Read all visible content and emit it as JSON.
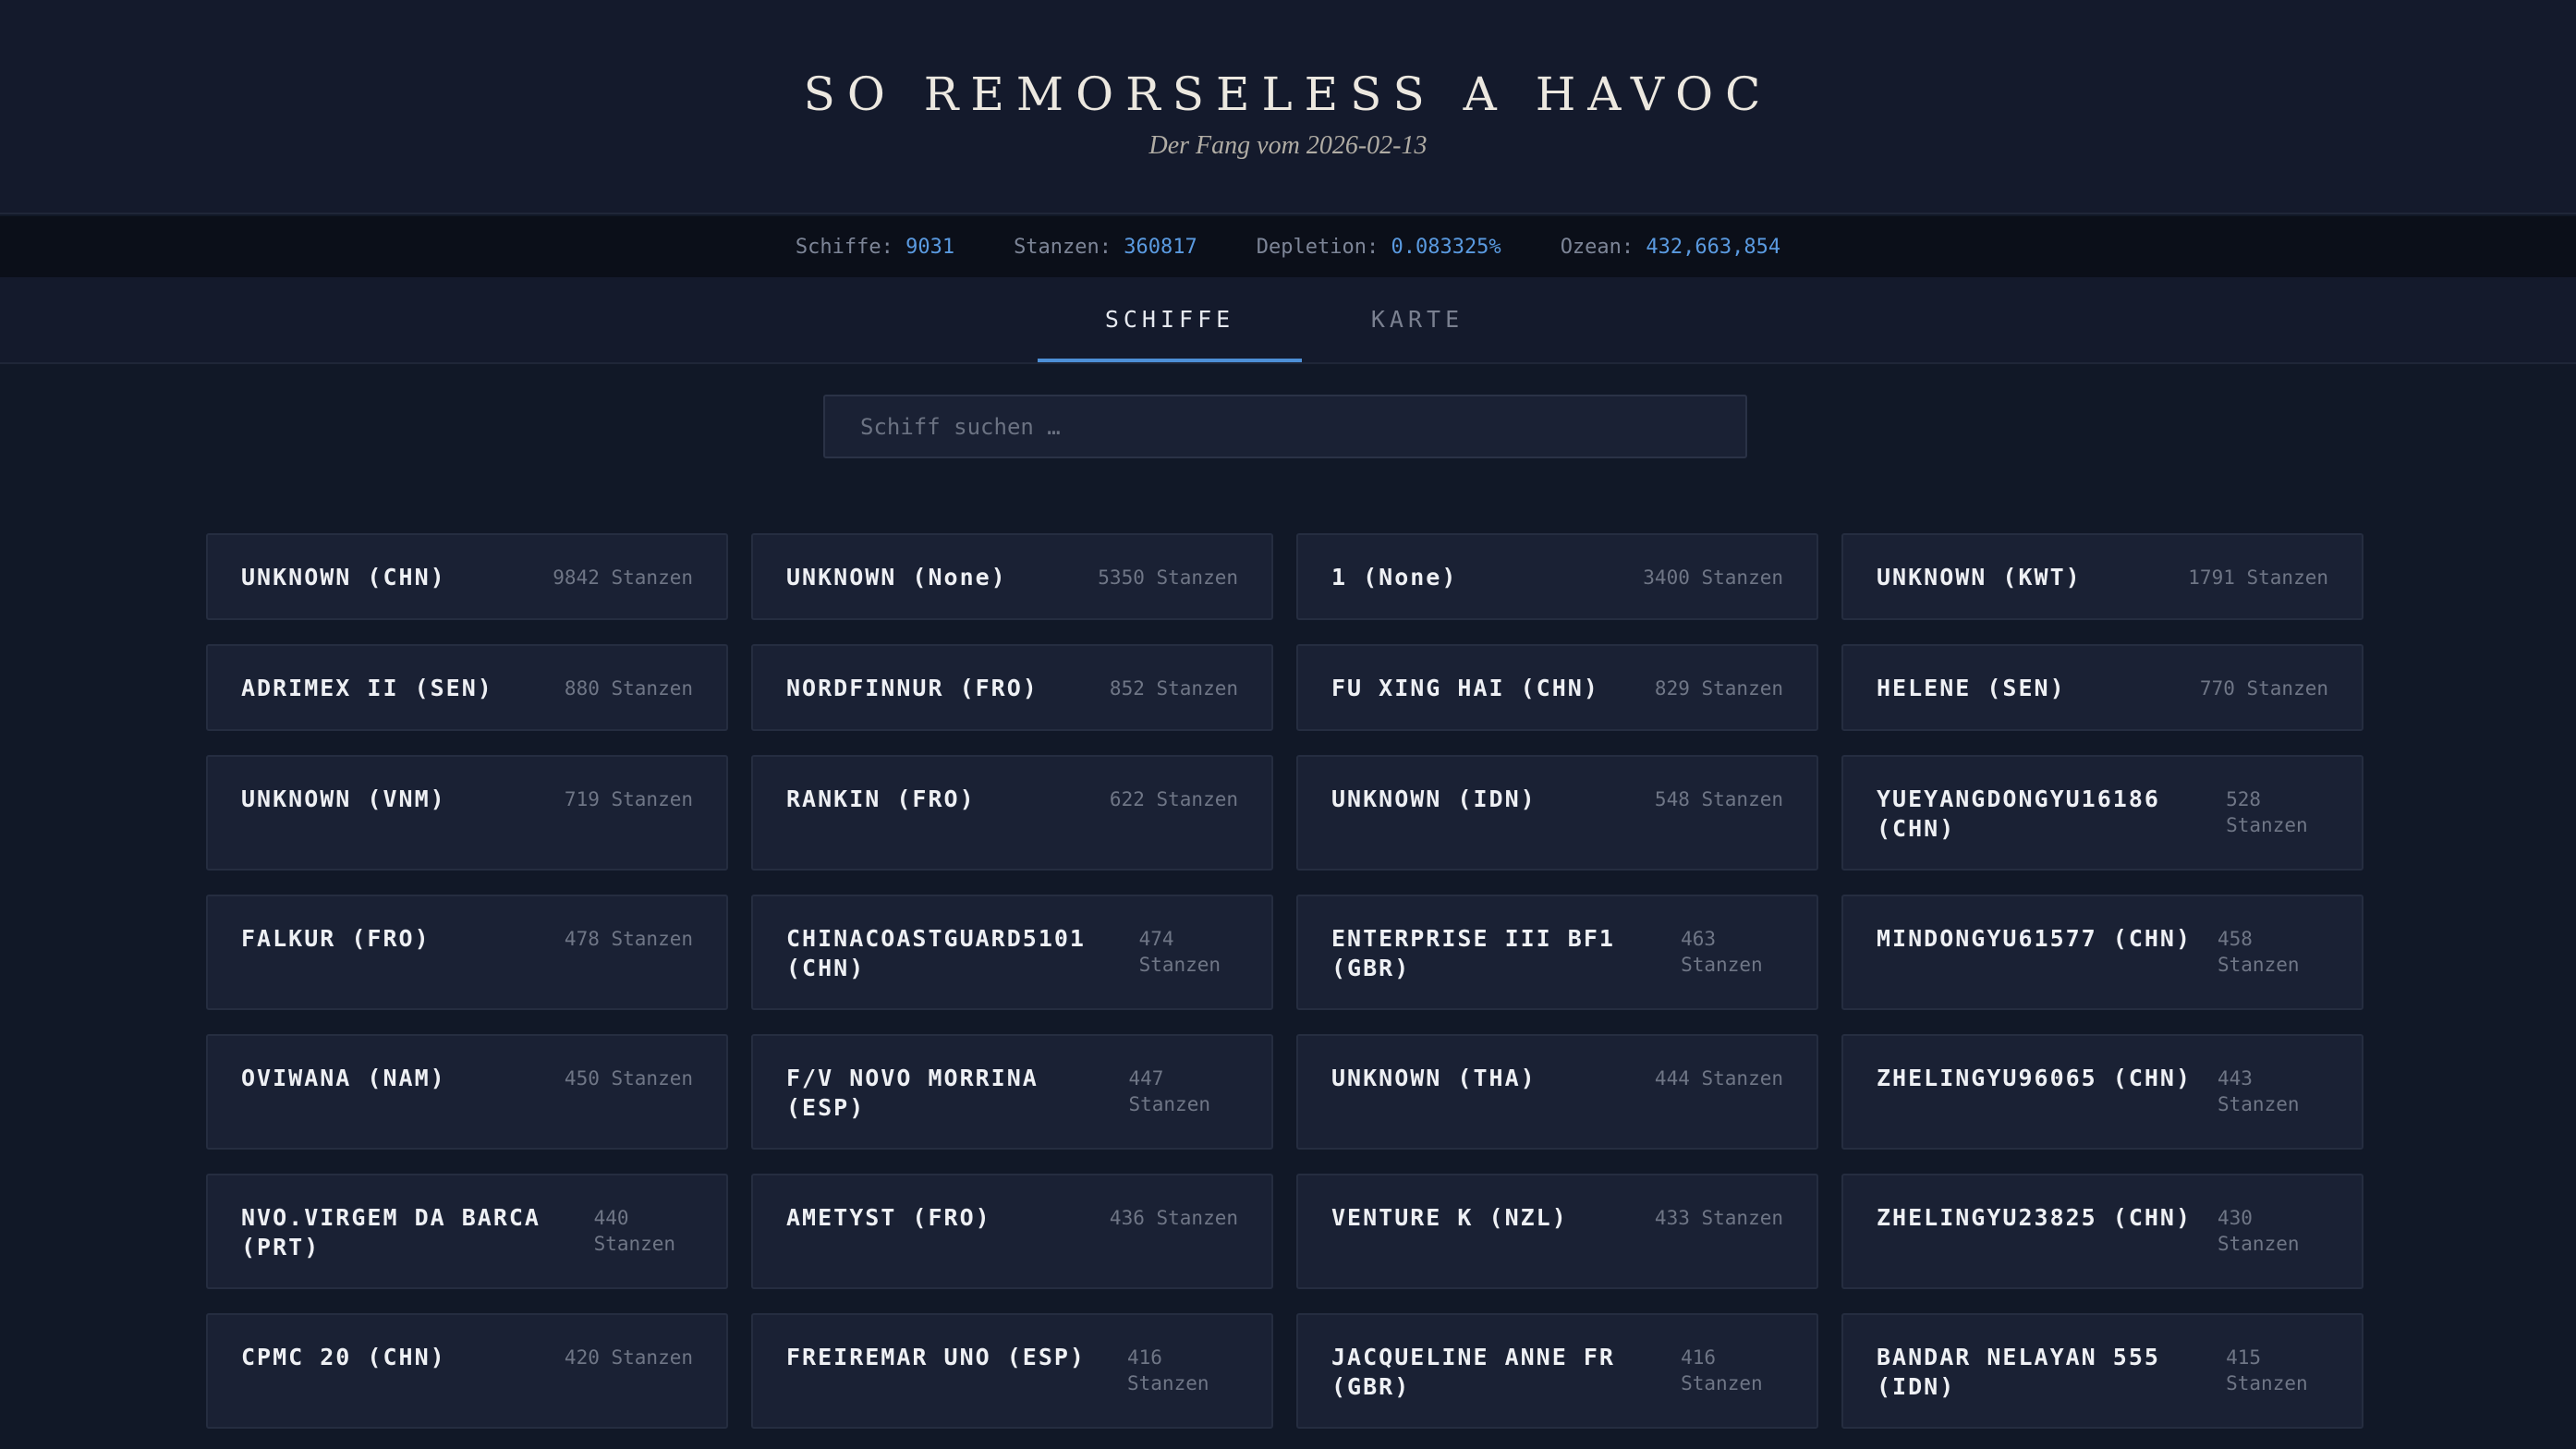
{
  "header": {
    "title": "SO REMORSELESS A HAVOC",
    "subtitle": "Der Fang vom 2026-02-13"
  },
  "stats": {
    "ships_label": "Schiffe:",
    "ships_value": "9031",
    "stanzen_label": "Stanzen:",
    "stanzen_value": "360817",
    "depletion_label": "Depletion:",
    "depletion_value": "0.083325%",
    "ocean_label": "Ozean:",
    "ocean_value": "432,663,854"
  },
  "tabs": {
    "ships": "SCHIFFE",
    "map": "KARTE"
  },
  "search": {
    "placeholder": "Schiff suchen …"
  },
  "ships": [
    {
      "name": "UNKNOWN (CHN)",
      "count": "9842 Stanzen"
    },
    {
      "name": "UNKNOWN (None)",
      "count": "5350 Stanzen"
    },
    {
      "name": "1 (None)",
      "count": "3400 Stanzen"
    },
    {
      "name": "UNKNOWN (KWT)",
      "count": "1791 Stanzen"
    },
    {
      "name": "ADRIMEX II (SEN)",
      "count": "880 Stanzen"
    },
    {
      "name": "NORDFINNUR (FRO)",
      "count": "852 Stanzen"
    },
    {
      "name": "FU XING HAI (CHN)",
      "count": "829 Stanzen"
    },
    {
      "name": "HELENE (SEN)",
      "count": "770 Stanzen"
    },
    {
      "name": "UNKNOWN (VNM)",
      "count": "719 Stanzen"
    },
    {
      "name": "RANKIN (FRO)",
      "count": "622 Stanzen"
    },
    {
      "name": "UNKNOWN (IDN)",
      "count": "548 Stanzen"
    },
    {
      "name": "YUEYANGDONGYU16186 (CHN)",
      "count": "528 Stanzen"
    },
    {
      "name": "FALKUR (FRO)",
      "count": "478 Stanzen"
    },
    {
      "name": "CHINACOASTGUARD5101 (CHN)",
      "count": "474 Stanzen"
    },
    {
      "name": "ENTERPRISE III BF1 (GBR)",
      "count": "463 Stanzen"
    },
    {
      "name": "MINDONGYU61577 (CHN)",
      "count": "458 Stanzen"
    },
    {
      "name": "OVIWANA (NAM)",
      "count": "450 Stanzen"
    },
    {
      "name": "F/V NOVO MORRINA (ESP)",
      "count": "447 Stanzen"
    },
    {
      "name": "UNKNOWN (THA)",
      "count": "444 Stanzen"
    },
    {
      "name": "ZHELINGYU96065 (CHN)",
      "count": "443 Stanzen"
    },
    {
      "name": "NVO.VIRGEM DA BARCA (PRT)",
      "count": "440 Stanzen"
    },
    {
      "name": "AMETYST (FRO)",
      "count": "436 Stanzen"
    },
    {
      "name": "VENTURE K (NZL)",
      "count": "433 Stanzen"
    },
    {
      "name": "ZHELINGYU23825 (CHN)",
      "count": "430 Stanzen"
    },
    {
      "name": "CPMC 20 (CHN)",
      "count": "420 Stanzen"
    },
    {
      "name": "FREIREMAR UNO (ESP)",
      "count": "416 Stanzen"
    },
    {
      "name": "JACQUELINE ANNE FR (GBR)",
      "count": "416 Stanzen"
    },
    {
      "name": "BANDAR NELAYAN 555 (IDN)",
      "count": "415 Stanzen"
    }
  ]
}
